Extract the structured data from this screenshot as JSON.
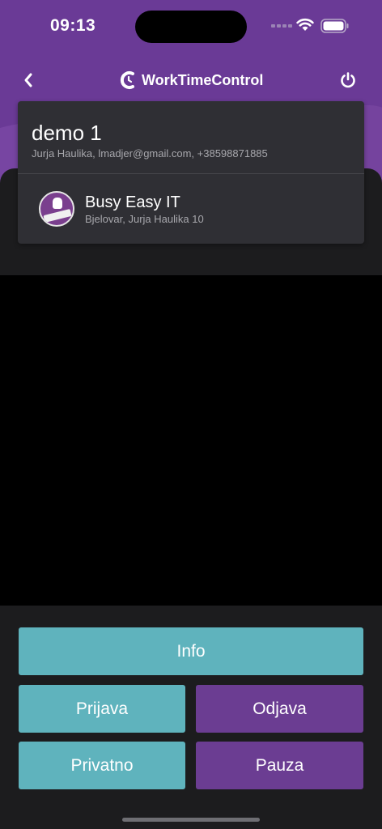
{
  "status_bar": {
    "time": "09:13",
    "icons": [
      "signal-icon",
      "wifi-icon",
      "battery-icon"
    ]
  },
  "header": {
    "app_name": "WorkTimeControl",
    "back_icon": "chevron-left-icon",
    "power_icon": "power-icon"
  },
  "user": {
    "name": "demo 1",
    "details": "Jurja Haulika, lmadjer@gmail.com, +38598871885"
  },
  "company": {
    "name": "Busy Easy IT",
    "address": "Bjelovar, Jurja Haulika 10",
    "logo": "busyeasy-logo"
  },
  "actions": {
    "info": "Info",
    "prijava": "Prijava",
    "odjava": "Odjava",
    "privatno": "Privatno",
    "pauza": "Pauza"
  },
  "colors": {
    "header_purple": "#6a3a96",
    "teal": "#5fb3bd",
    "purple": "#6b3d92",
    "card": "#2f2f34",
    "background": "#1c1c1e"
  }
}
